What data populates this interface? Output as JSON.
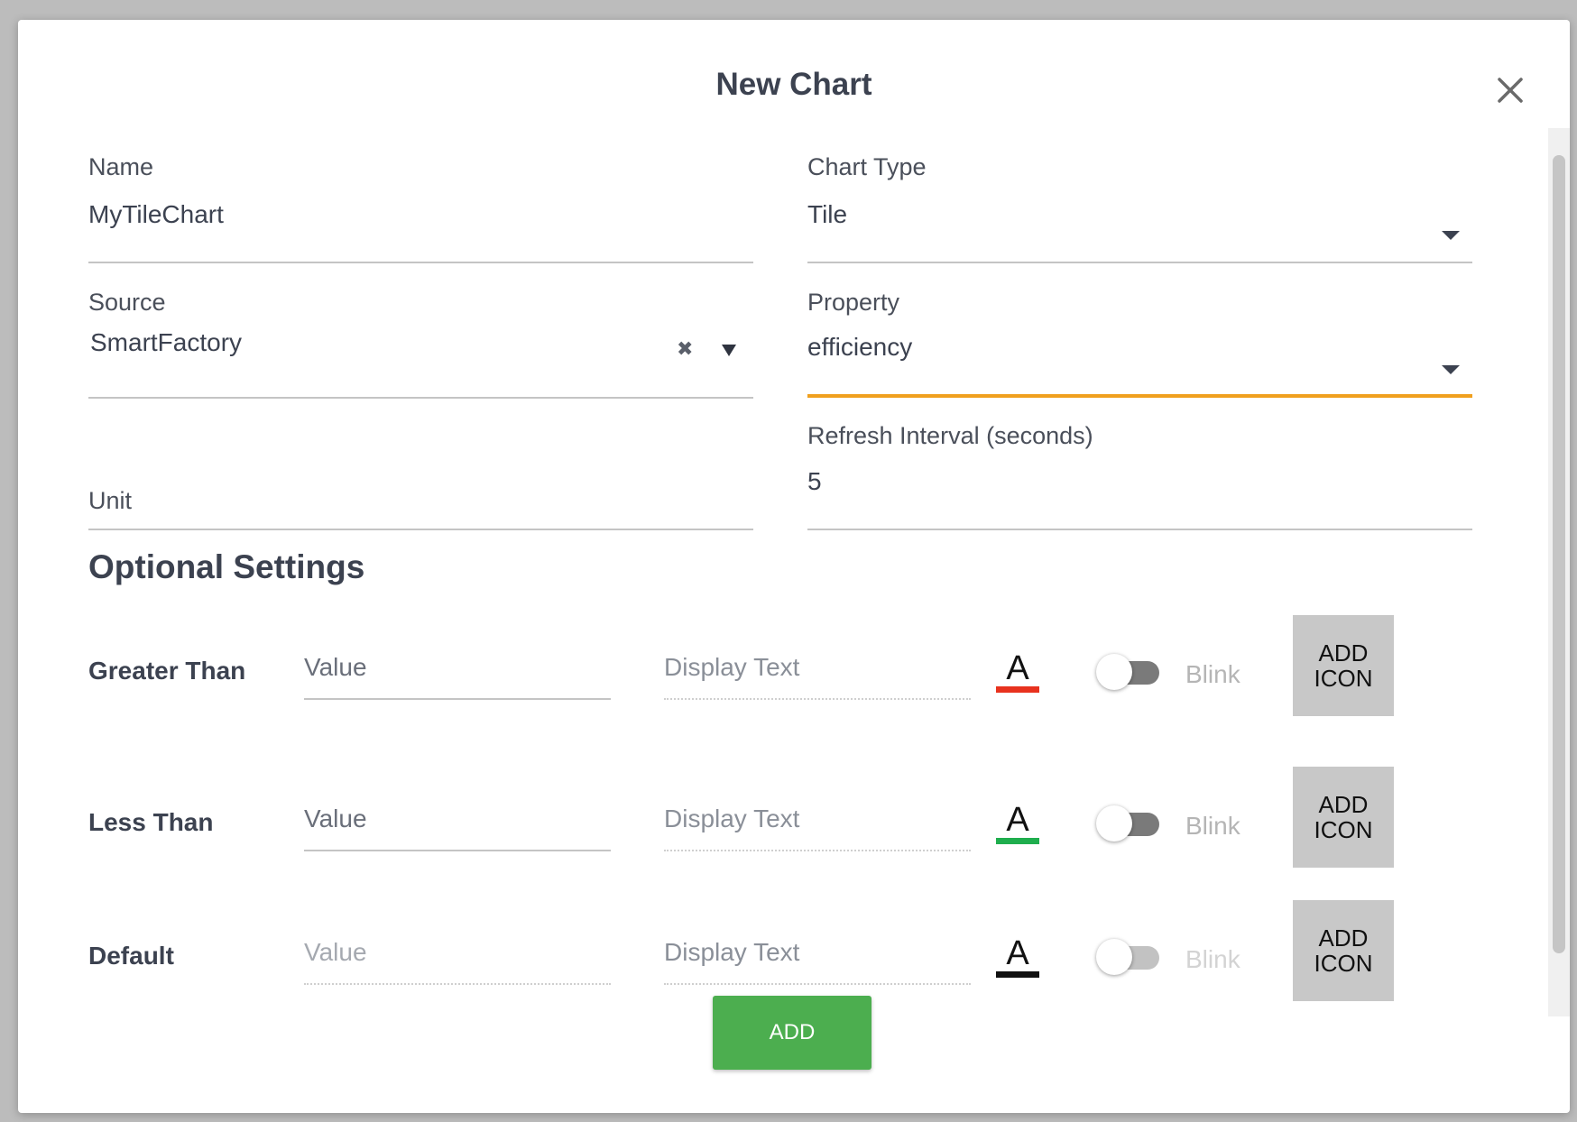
{
  "dialog": {
    "title": "New Chart",
    "close_icon": "close-icon"
  },
  "fields": {
    "name": {
      "label": "Name",
      "value": "MyTileChart"
    },
    "chart_type": {
      "label": "Chart Type",
      "value": "Tile"
    },
    "source": {
      "label": "Source",
      "value": "SmartFactory",
      "clear_glyph": "✖"
    },
    "property": {
      "label": "Property",
      "value": "efficiency"
    },
    "unit": {
      "label": "Unit",
      "value": ""
    },
    "refresh": {
      "label": "Refresh Interval (seconds)",
      "value": "5"
    }
  },
  "optional": {
    "title": "Optional Settings",
    "rows": [
      {
        "label": "Greater Than",
        "value_placeholder": "Value",
        "display_placeholder": "Display Text",
        "color_glyph": "A",
        "color": "#e8321e",
        "blink_label": "Blink",
        "icon_button": "ADD ICON"
      },
      {
        "label": "Less Than",
        "value_placeholder": "Value",
        "display_placeholder": "Display Text",
        "color_glyph": "A",
        "color": "#1fae4e",
        "blink_label": "Blink",
        "icon_button": "ADD ICON"
      },
      {
        "label": "Default",
        "value_placeholder": "Value",
        "display_placeholder": "Display Text",
        "color_glyph": "A",
        "color": "#111111",
        "blink_label": "Blink",
        "icon_button": "ADD ICON"
      }
    ]
  },
  "footer": {
    "add_label": "ADD"
  },
  "colors": {
    "accent_focus": "#f0a01e",
    "primary_button": "#4cae4f"
  }
}
